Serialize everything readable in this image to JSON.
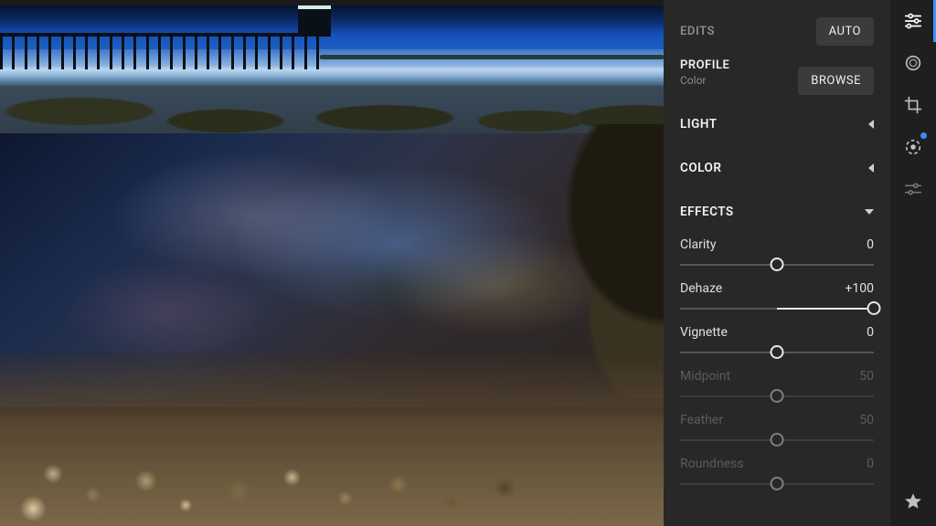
{
  "panel": {
    "edits_label": "EDITS",
    "auto_label": "AUTO",
    "profile_label": "PROFILE",
    "profile_value": "Color",
    "browse_label": "BROWSE",
    "light_label": "LIGHT",
    "color_label": "COLOR",
    "effects_label": "EFFECTS"
  },
  "effects": {
    "clarity": {
      "label": "Clarity",
      "value_text": "0",
      "percent": 50,
      "fill_from": 50,
      "fill_to": 50,
      "enabled": true
    },
    "dehaze": {
      "label": "Dehaze",
      "value_text": "+100",
      "percent": 100,
      "fill_from": 50,
      "fill_to": 100,
      "enabled": true
    },
    "vignette": {
      "label": "Vignette",
      "value_text": "0",
      "percent": 50,
      "fill_from": 50,
      "fill_to": 50,
      "enabled": true
    },
    "midpoint": {
      "label": "Midpoint",
      "value_text": "50",
      "percent": 50,
      "fill_from": 0,
      "fill_to": 0,
      "enabled": false
    },
    "feather": {
      "label": "Feather",
      "value_text": "50",
      "percent": 50,
      "fill_from": 0,
      "fill_to": 0,
      "enabled": false
    },
    "roundness": {
      "label": "Roundness",
      "value_text": "0",
      "percent": 50,
      "fill_from": 0,
      "fill_to": 0,
      "enabled": false
    }
  },
  "toolstrip": {
    "edit_icon": "sliders-icon",
    "healing_icon": "healing-brush-icon",
    "crop_icon": "crop-icon",
    "presets_icon": "preset-circle-icon",
    "adjust_icon": "local-adjust-icon",
    "rate_icon": "star-icon"
  }
}
